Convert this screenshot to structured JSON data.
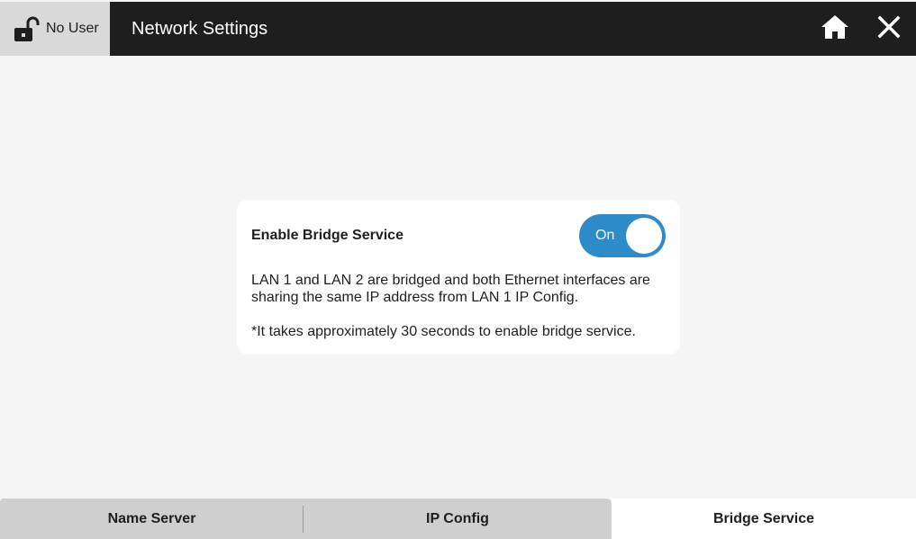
{
  "header": {
    "user_label": "No User",
    "title": "Network Settings",
    "icons": {
      "user": "unlocked-padlock-icon",
      "home": "home-icon",
      "close": "close-icon"
    }
  },
  "bridge": {
    "label": "Enable Bridge Service",
    "toggle_state": "On",
    "description": "LAN 1 and LAN 2 are bridged and both Ethernet interfaces are sharing the same IP address from LAN 1 IP Config.",
    "note": "*It takes approximately 30 seconds to enable bridge service."
  },
  "tabs": [
    {
      "label": "Name Server",
      "active": false
    },
    {
      "label": "IP Config",
      "active": false
    },
    {
      "label": "Bridge Service",
      "active": true
    }
  ],
  "colors": {
    "header_bg": "#1e1e1e",
    "user_box_bg": "#d9d9d9",
    "page_bg": "#f5f5f5",
    "toggle_on": "#2e8bc9",
    "tab_inactive": "#cfcfcf",
    "tab_active": "#ffffff"
  }
}
